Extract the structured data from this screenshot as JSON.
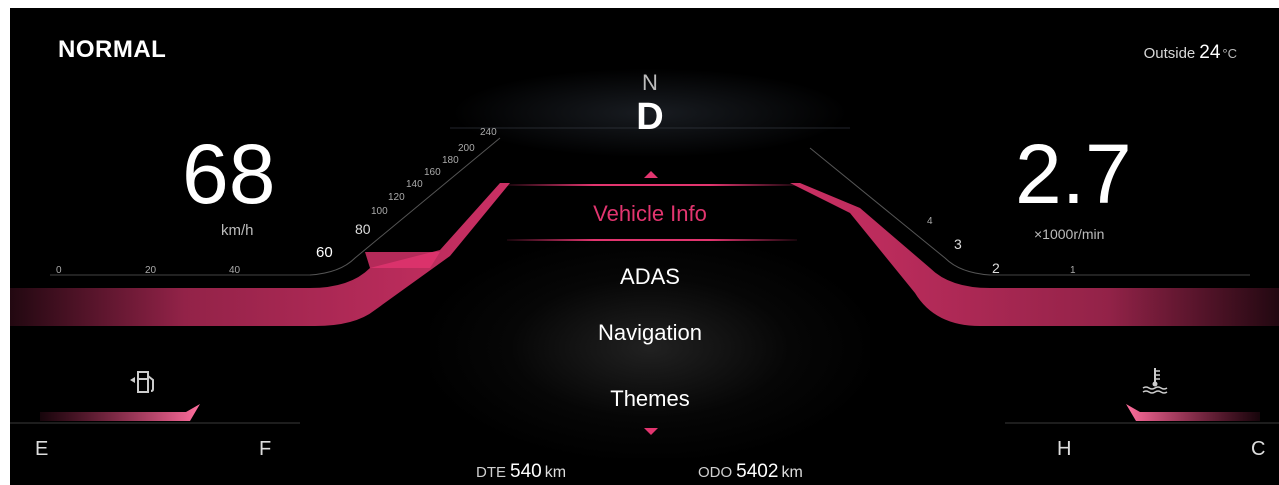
{
  "drive_mode": "NORMAL",
  "outside": {
    "label": "Outside",
    "value": "24",
    "unit": "°C"
  },
  "gear": {
    "previous": "N",
    "current": "D"
  },
  "speedometer": {
    "value": "68",
    "unit": "km/h",
    "ticks": [
      "0",
      "20",
      "40",
      "60",
      "80",
      "100",
      "120",
      "140",
      "160",
      "180",
      "200",
      "240"
    ]
  },
  "tachometer": {
    "value": "2.7",
    "unit": "×1000r/min",
    "ticks": [
      "1",
      "2",
      "3",
      "4"
    ]
  },
  "menu": {
    "items": [
      "Vehicle Info",
      "ADAS",
      "Navigation",
      "Themes"
    ],
    "selected": "Vehicle Info"
  },
  "fuel_gauge": {
    "empty": "E",
    "full": "F",
    "icon": "fuel-pump-icon"
  },
  "temp_gauge": {
    "hot": "H",
    "cold": "C",
    "icon": "coolant-temperature-icon"
  },
  "dte": {
    "label": "DTE",
    "value": "540",
    "unit": "km"
  },
  "odo": {
    "label": "ODO",
    "value": "5402",
    "unit": "km"
  },
  "colors": {
    "accent": "#e2356f",
    "background": "#000000",
    "text": "#ffffff"
  }
}
